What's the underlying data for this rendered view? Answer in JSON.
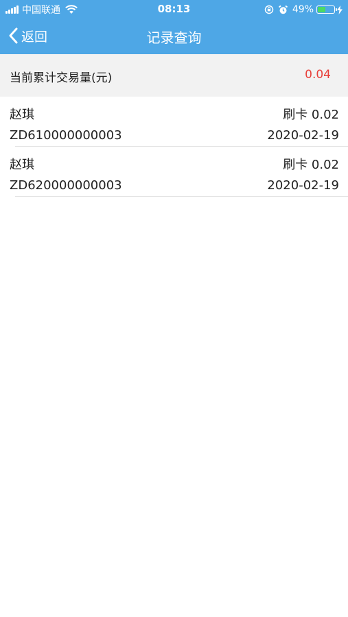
{
  "status_bar": {
    "carrier": "中国联通",
    "time": "08:13",
    "battery_percent": "49%",
    "battery_level": 0.49,
    "icons": [
      "signal-icon",
      "wifi-icon",
      "rotation-lock-icon",
      "alarm-icon",
      "battery-icon",
      "charging-icon"
    ]
  },
  "nav": {
    "back_label": "返回",
    "title": "记录查询",
    "back_icon": "chevron-left-icon"
  },
  "summary": {
    "label": "当前累计交易量(元)",
    "value": "0.04"
  },
  "records": [
    {
      "name": "赵琪",
      "type": "刷卡 0.02",
      "order_no": "ZD610000000003",
      "date": "2020-02-19"
    },
    {
      "name": "赵琪",
      "type": "刷卡 0.02",
      "order_no": "ZD620000000003",
      "date": "2020-02-19"
    }
  ],
  "colors": {
    "header_bg": "#4ea7e6",
    "summary_bg": "#f2f2f2",
    "summary_value": "#e8403a",
    "battery_fill": "#4cd964"
  }
}
